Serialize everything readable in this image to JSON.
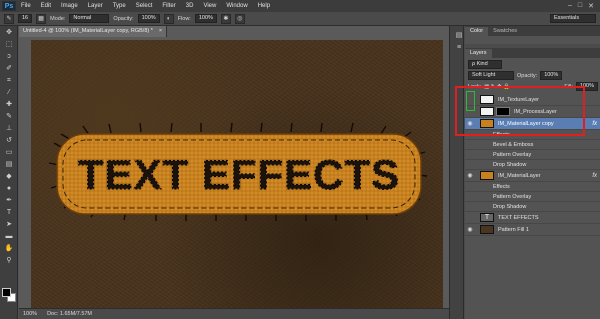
{
  "app": {
    "logo": "Ps"
  },
  "menu": [
    "File",
    "Edit",
    "Image",
    "Layer",
    "Type",
    "Select",
    "Filter",
    "3D",
    "View",
    "Window",
    "Help"
  ],
  "window_controls": [
    "–",
    "□",
    "✕"
  ],
  "options": {
    "size": "16",
    "mode_label": "Mode:",
    "mode_value": "Normal",
    "opacity_label": "Opacity:",
    "opacity_value": "100%",
    "flow_label": "Flow:",
    "flow_value": "100%",
    "workspace": "Essentials"
  },
  "document": {
    "tab_title": "Untitled-4 @ 100% (IM_MaterialLayer copy, RGB/8) *",
    "tab_close": "×",
    "canvas_text": "TEXT EFFECTS"
  },
  "status": {
    "zoom": "100%",
    "doc_info": "Doc: 1.65M/7.57M"
  },
  "color_panel": {
    "tabs": [
      "Color",
      "Swatches"
    ]
  },
  "layers_panel": {
    "tab": "Layers",
    "kind_label": "ρ Kind",
    "blend_mode": "Soft Light",
    "opacity_label": "Opacity:",
    "opacity_value": "100%",
    "lock_label": "Lock:",
    "fill_label": "Fill:",
    "fill_value": "100%",
    "layers": [
      {
        "name": "IM_TextureLayer",
        "visible": false,
        "selected": false
      },
      {
        "name": "IM_ProcessLayer",
        "visible": false,
        "selected": false
      },
      {
        "name": "IM_MaterialLayer copy",
        "visible": true,
        "selected": true,
        "fx": "fx"
      },
      {
        "name": "Effects",
        "sub": true
      },
      {
        "name": "Bevel & Emboss",
        "sub": true
      },
      {
        "name": "Pattern Overlay",
        "sub": true
      },
      {
        "name": "Drop Shadow",
        "sub": true
      },
      {
        "name": "IM_MaterialLayer",
        "visible": true,
        "selected": false,
        "fx": "fx"
      },
      {
        "name": "Effects",
        "sub": true
      },
      {
        "name": "Pattern Overlay",
        "sub": true
      },
      {
        "name": "Drop Shadow",
        "sub": true
      },
      {
        "name": "TEXT EFFECTS",
        "visible": false,
        "text_layer": true
      },
      {
        "name": "Pattern Fill 1",
        "visible": true
      }
    ]
  }
}
